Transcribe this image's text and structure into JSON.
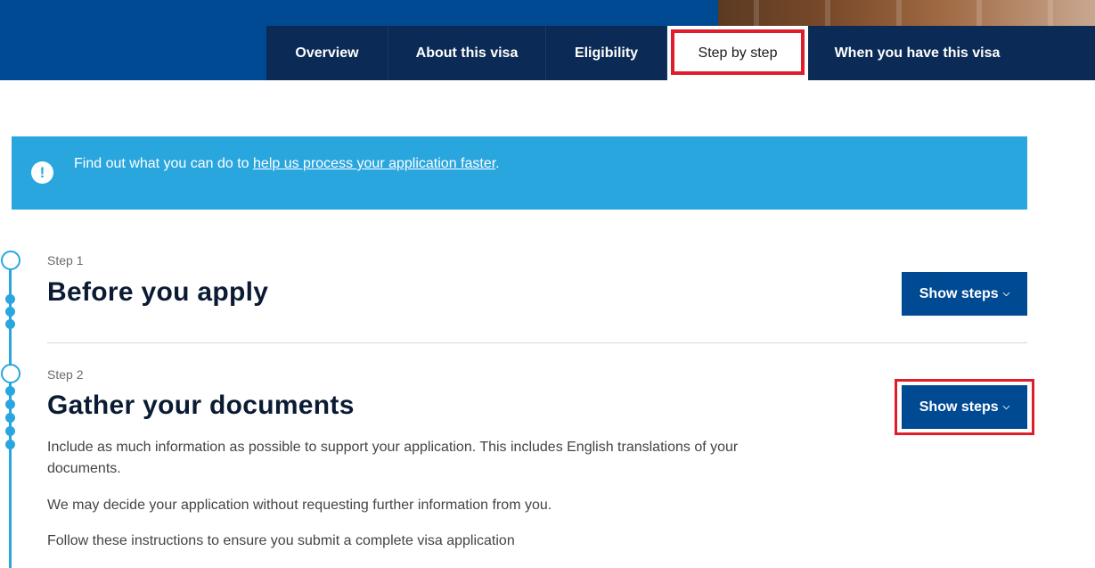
{
  "nav": {
    "tabs": [
      {
        "label": "Overview"
      },
      {
        "label": "About this visa"
      },
      {
        "label": "Eligibility"
      },
      {
        "label": "Step by step"
      },
      {
        "label": "When you have this visa"
      }
    ],
    "active_tab": "Step by step"
  },
  "alert": {
    "icon": "exclamation-icon",
    "text_before": "Find out what you can do to ",
    "link_text": "help us process your application faster",
    "text_after": "."
  },
  "steps": [
    {
      "label": "Step 1",
      "title": "Before you apply",
      "button_label": "Show steps"
    },
    {
      "label": "Step 2",
      "title": "Gather your documents",
      "button_label": "Show steps",
      "paragraphs": [
        "Include as much information as possible to support your application. This includes English translations of your documents.",
        "We may decide your application without requesting further information from you.",
        "Follow these instructions to ensure you submit a complete visa application"
      ]
    }
  ],
  "colors": {
    "brand_blue": "#004a93",
    "tab_bar": "#0b2a55",
    "alert_blue": "#2aa6df",
    "highlight_red": "#e01e2b"
  }
}
